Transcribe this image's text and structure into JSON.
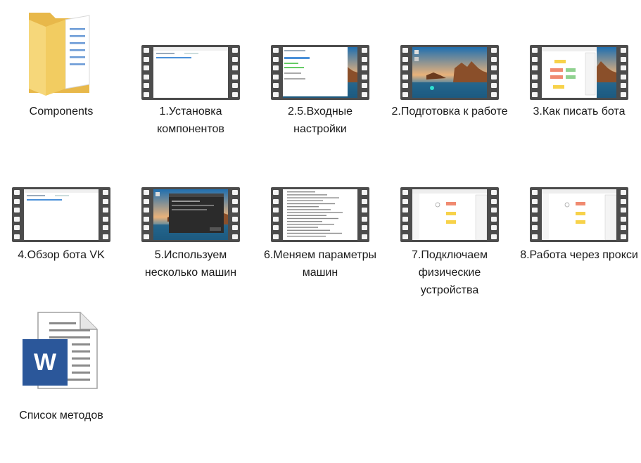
{
  "items": [
    {
      "label": "Components",
      "type": "folder",
      "icon": "folder-icon"
    },
    {
      "label": "1.Установка компонентов",
      "type": "video",
      "thumb": "blank-window"
    },
    {
      "label": "2.5.Входные настройки",
      "type": "video",
      "thumb": "window-desktop"
    },
    {
      "label": "2.Подготовка к работе",
      "type": "video",
      "thumb": "desktop"
    },
    {
      "label": "3.Как писать бота",
      "type": "video",
      "thumb": "flowchart-desktop"
    },
    {
      "label": "4.Обзор бота VK",
      "type": "video",
      "thumb": "blank-window"
    },
    {
      "label": "5.Используем несколько машин",
      "type": "video",
      "thumb": "dark-dialog"
    },
    {
      "label": "6.Меняем параметры машин",
      "type": "video",
      "thumb": "text-list"
    },
    {
      "label": "7.Подключаем физические устройства",
      "type": "video",
      "thumb": "flowchart"
    },
    {
      "label": "8.Работа через прокси",
      "type": "video",
      "thumb": "flowchart"
    },
    {
      "label": "Список методов",
      "type": "word",
      "icon": "word-document-icon",
      "badge": "W"
    }
  ],
  "colors": {
    "folder_back": "#e8b84a",
    "folder_front": "#f6d77a",
    "word_blue": "#2b579a",
    "film_frame": "#4c4c4c"
  }
}
